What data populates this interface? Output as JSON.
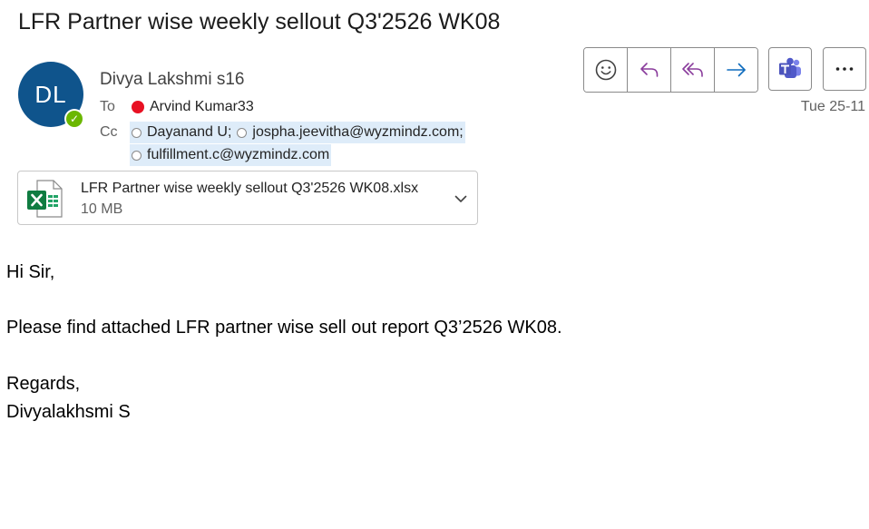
{
  "email": {
    "subject": "LFR Partner wise weekly sellout Q3'2526 WK08",
    "sender": {
      "initials": "DL",
      "name": "Divya Lakshmi s16"
    },
    "to_label": "To",
    "cc_label": "Cc",
    "to": [
      {
        "name": "Arvind Kumar33",
        "status_color": "#e81123"
      }
    ],
    "cc": [
      {
        "name": "Dayanand U;"
      },
      {
        "name": "jospha.jeevitha@wyzmindz.com;"
      },
      {
        "name": "fulfillment.c@wyzmindz.com"
      }
    ],
    "date": "Tue 25-11",
    "attachment": {
      "filename": "LFR Partner wise weekly sellout Q3'2526 WK08.xlsx",
      "size": "10 MB",
      "icon": "excel-file-icon"
    },
    "body": {
      "greeting": "Hi Sir,",
      "message": "Please find attached LFR partner wise sell out report Q3’2526 WK08.",
      "closing": "Regards,",
      "signature": "Divyalakhsmi S"
    }
  },
  "toolbar": {
    "icons": [
      "emoji-icon",
      "reply-icon",
      "reply-all-icon",
      "forward-icon",
      "teams-icon",
      "more-icon"
    ]
  },
  "colors": {
    "avatar_bg": "#0f548c",
    "presence_available": "#6bb700",
    "reply_purple": "#8a3c9c",
    "forward_blue": "#0f6cbd",
    "teams_purple": "#4b53bc",
    "excel_green": "#107c41",
    "recipient_highlight": "#deecf9"
  }
}
